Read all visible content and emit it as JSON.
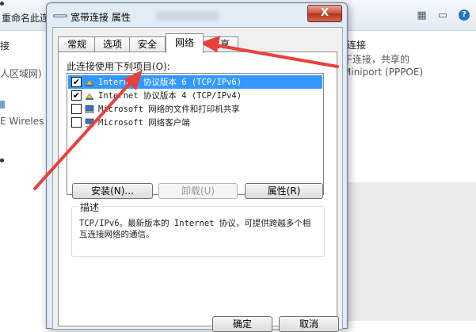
{
  "background_window": {
    "toolbar_rename": "重命名此连",
    "left_connection": {
      "name": "接",
      "line1": "人区域网)",
      "line2": "E Wireles"
    },
    "right_connection": {
      "name": "连接",
      "line1": "干连接，共享的",
      "line2": "Miniport (PPPOE)"
    }
  },
  "dialog": {
    "title": "宽带连接 属性",
    "close_label": "X",
    "tabs": [
      "常规",
      "选项",
      "安全",
      "网络",
      "共享"
    ],
    "active_tab": "网络",
    "items_label": "此连接使用下列项目(O):",
    "items": [
      {
        "label": "Internet 协议版本 6 (TCP/IPv6)",
        "checked": true,
        "selected": true,
        "checkmark": "✔",
        "icon": "protocol-icon"
      },
      {
        "label": "Internet 协议版本 4 (TCP/IPv4)",
        "checked": true,
        "selected": false,
        "checkmark": "✔",
        "icon": "protocol-icon"
      },
      {
        "label": "Microsoft 网络的文件和打印机共享",
        "checked": false,
        "selected": false,
        "checkmark": "",
        "icon": "printer-share-icon"
      },
      {
        "label": "Microsoft 网络客户端",
        "checked": false,
        "selected": false,
        "checkmark": "",
        "icon": "network-client-icon"
      }
    ],
    "buttons": {
      "install": "安装(N)...",
      "uninstall": "卸载(U)",
      "properties": "属性(R)"
    },
    "description_title": "描述",
    "description_text": "TCP/IPv6。最新版本的 Internet 协议，可提供跨越多个相互连接网络的通信。",
    "footer": {
      "ok": "确定",
      "cancel": "取消"
    }
  },
  "annotations": {
    "arrow_color": "#e8413c"
  }
}
